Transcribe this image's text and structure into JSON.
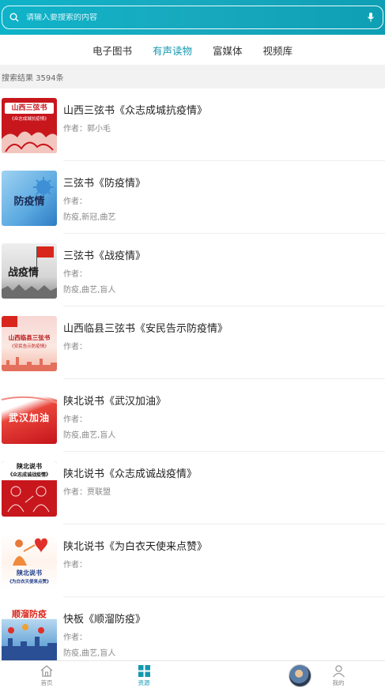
{
  "search": {
    "placeholder": "请输入要搜索的内容"
  },
  "tabs": [
    {
      "label": "电子图书",
      "active": false
    },
    {
      "label": "有声读物",
      "active": true
    },
    {
      "label": "富媒体",
      "active": false
    },
    {
      "label": "视频库",
      "active": false
    }
  ],
  "result_count": "搜索结果 3594条",
  "items": [
    {
      "title": "山西三弦书《众志成城抗疫情》",
      "author": "作者：郭小毛",
      "tags": "",
      "cover_text": "山西三弦书",
      "cover_sub": "《众志成城抗疫情》"
    },
    {
      "title": "三弦书《防疫情》",
      "author": "作者：",
      "tags": "防疫,新冠,曲艺",
      "cover_text": "防疫情",
      "cover_sub": ""
    },
    {
      "title": "三弦书《战疫情》",
      "author": "作者：",
      "tags": "防疫,曲艺,盲人",
      "cover_text": "战疫情",
      "cover_sub": ""
    },
    {
      "title": "山西临县三弦书《安民告示防疫情》",
      "author": "作者：",
      "tags": "",
      "cover_text": "山西临县三弦书",
      "cover_sub": "《安民告示防疫情》"
    },
    {
      "title": "陕北说书《武汉加油》",
      "author": "作者：",
      "tags": "防疫,曲艺,盲人",
      "cover_text": "武汉加油",
      "cover_sub": ""
    },
    {
      "title": "陕北说书《众志成诚战疫情》",
      "author": "作者：贾联盟",
      "tags": "",
      "cover_text": "陕北说书",
      "cover_sub": "《众志成诚战疫情》"
    },
    {
      "title": "陕北说书《为白衣天使来点赞》",
      "author": "作者：",
      "tags": "",
      "cover_text": "陕北说书",
      "cover_sub": "《为白衣天使来点赞》"
    },
    {
      "title": "快板《顺溜防疫》",
      "author": "作者：",
      "tags": "防疫,曲艺,盲人",
      "cover_text": "顺溜防疫",
      "cover_sub": ""
    }
  ],
  "nav": {
    "home": "首页",
    "resources": "资源",
    "mine": "我的"
  },
  "colors": {
    "accent": "#1598b0",
    "header": "#13aabf"
  }
}
